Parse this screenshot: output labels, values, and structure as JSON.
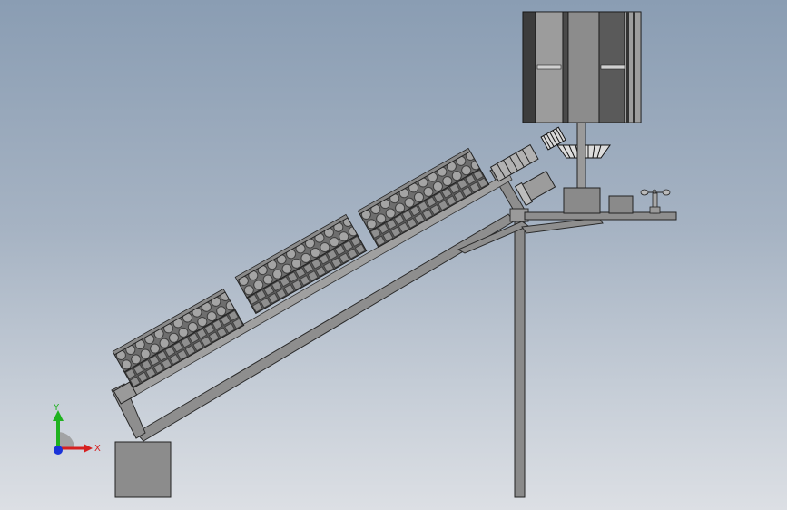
{
  "viewport": {
    "background_top": "#8a9db3",
    "background_bottom": "#dcdfe4"
  },
  "model": {
    "colors": {
      "frame": "#8a8a8a",
      "frame_edge": "#333333",
      "panel_fill": "#6f6f6f",
      "panel_cell": "#9a9a9a",
      "turbine_dark": "#3e3e3e",
      "turbine_light": "#9a9a9a"
    },
    "parts": [
      "solar-collector-modules",
      "support-frame",
      "wind-turbine",
      "gearbox",
      "anemometer",
      "base-block"
    ]
  },
  "triad": {
    "x_label": "X",
    "y_label": "Y",
    "colors": {
      "x": "#d62020",
      "y": "#1fb21f",
      "z": "#1a33d9"
    }
  }
}
